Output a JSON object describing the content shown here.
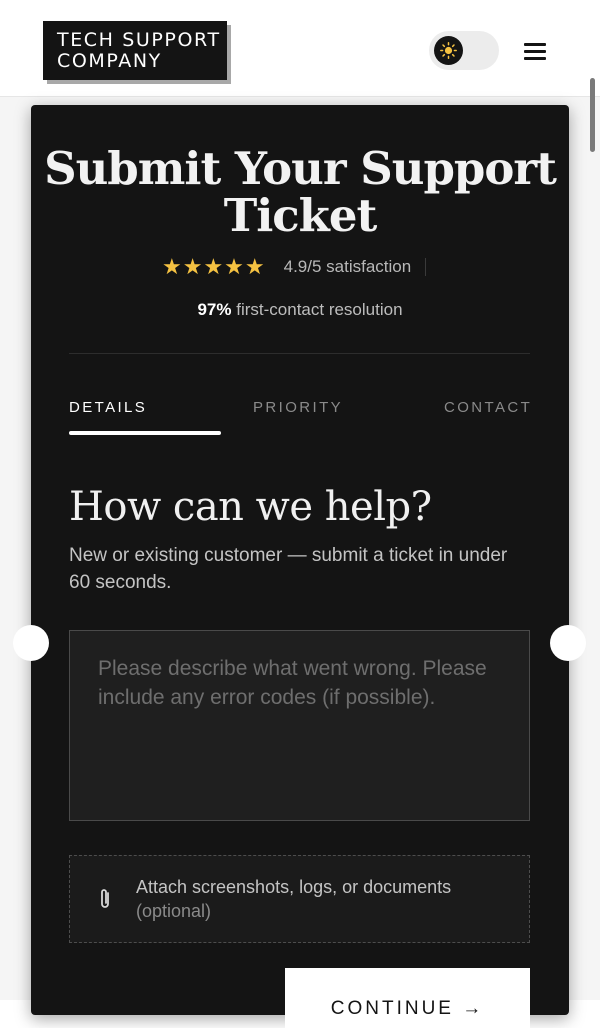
{
  "header": {
    "logo_line1": "TECH SUPPORT",
    "logo_line2": "COMPANY",
    "theme_toggle_icon": "sun-icon",
    "menu_icon": "hamburger-menu-icon"
  },
  "hero": {
    "title": "Submit Your Support Ticket",
    "stars": "★★★★★",
    "rating_text": "4.9/5 satisfaction",
    "resolution_value": "97%",
    "resolution_text": "first-contact resolution"
  },
  "tabs": [
    {
      "label": "DETAILS",
      "active": true
    },
    {
      "label": "PRIORITY",
      "active": false
    },
    {
      "label": "CONTACT",
      "active": false
    }
  ],
  "form": {
    "heading": "How can we help?",
    "subheading": "New or existing customer — submit a ticket in under 60 seconds.",
    "description_placeholder": "Please describe what went wrong. Please include any error codes (if possible).",
    "attach_label": "Attach screenshots, logs, or documents",
    "attach_optional": "(optional)",
    "continue_label": "CONTINUE →"
  },
  "colors": {
    "card_background": "#141414",
    "star_color": "#f5c242",
    "page_background": "#ffffff"
  }
}
